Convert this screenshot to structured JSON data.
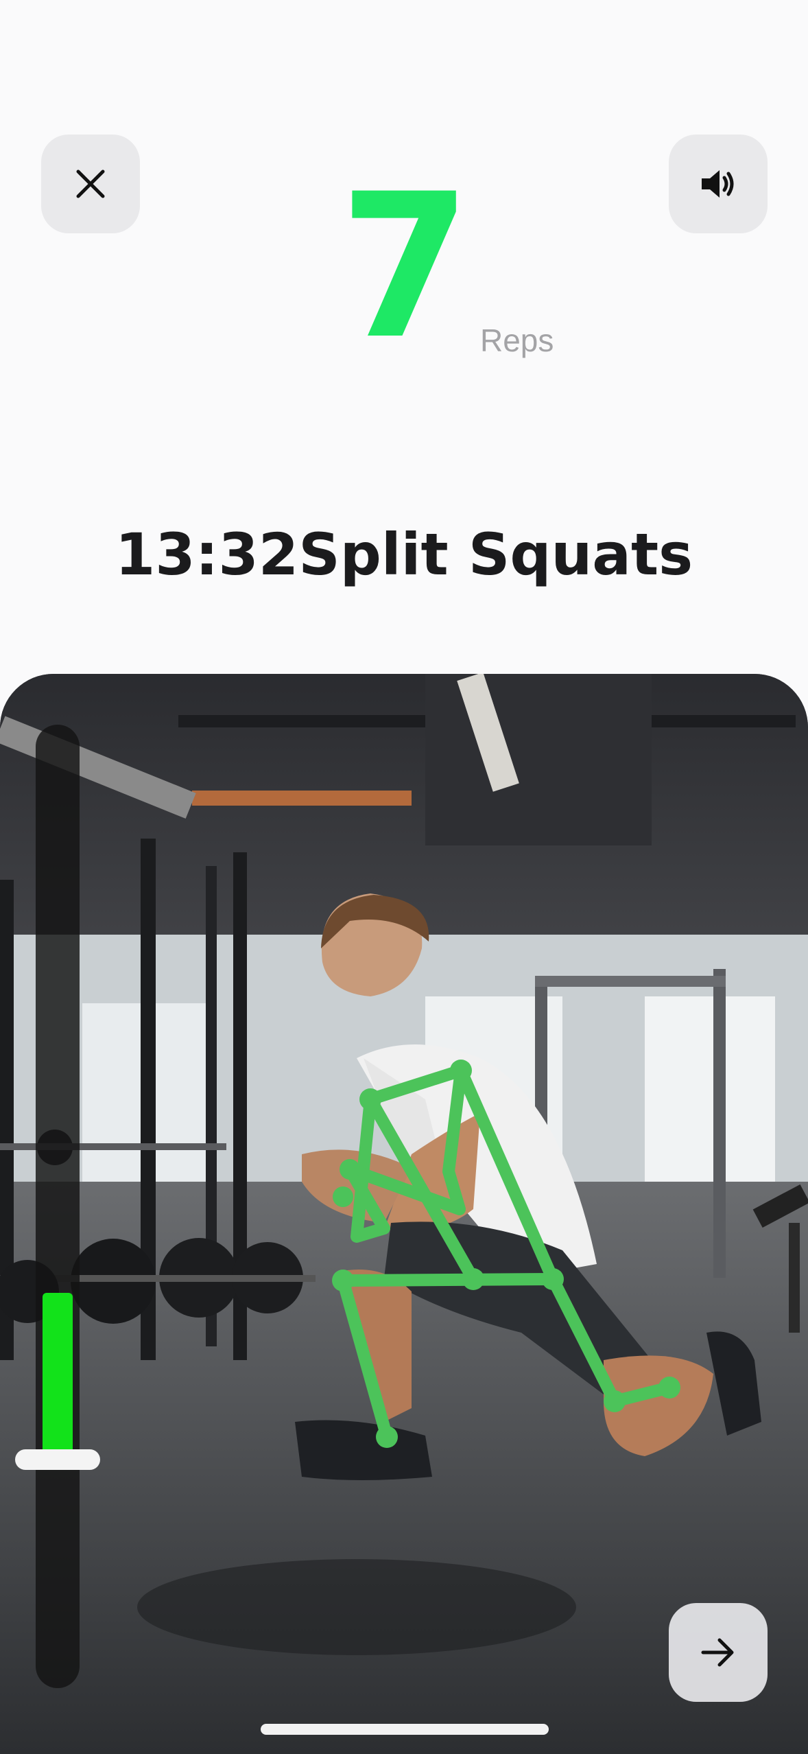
{
  "screen": {
    "rep_count": "7",
    "rep_label": "Reps",
    "timer": "13:32",
    "exercise": "Split Squats",
    "buttons": {
      "close_icon": "close-icon",
      "sound_icon": "speaker-icon",
      "next_icon": "arrow-right-icon"
    }
  },
  "depth_meter": {
    "level": 0.2
  },
  "colors": {
    "accent_green": "#1ee865",
    "skeleton_green": "#4cc35a",
    "meter_green": "#12e21a"
  }
}
